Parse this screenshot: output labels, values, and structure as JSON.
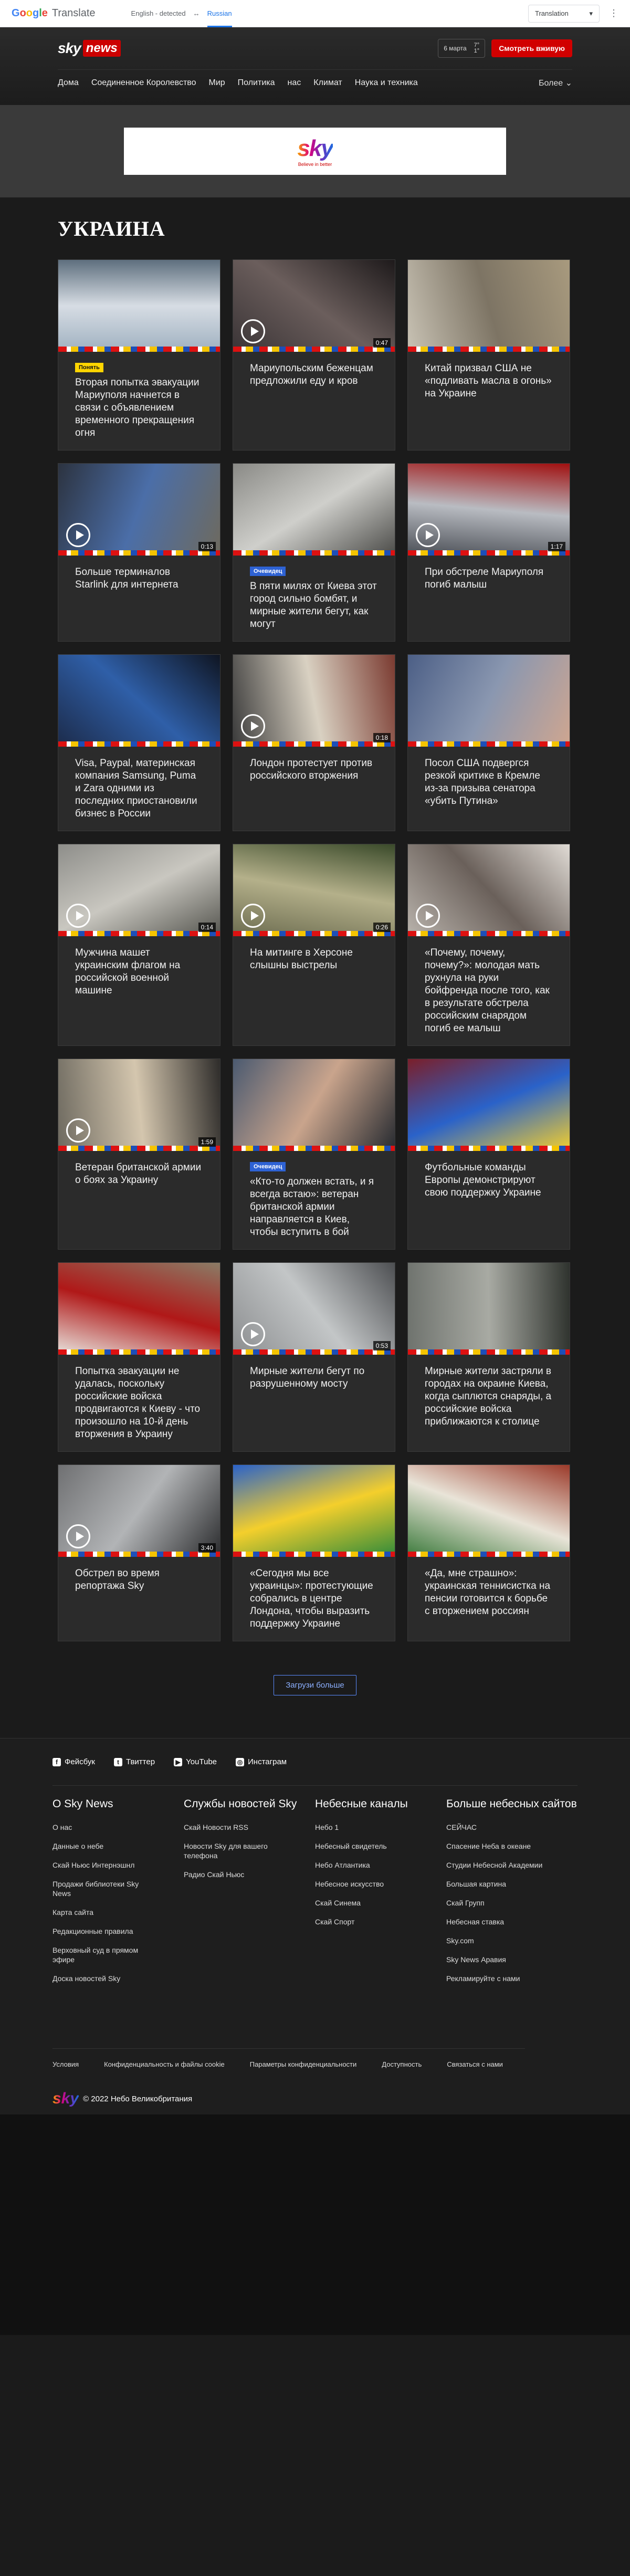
{
  "translate_bar": {
    "logo_google": "Google",
    "logo_translate": "Translate",
    "source_lang": "English - detected",
    "arrow": "↔",
    "target_lang": "Russian",
    "mode": "Translation",
    "menu": "⋮"
  },
  "header": {
    "logo_sky": "sky",
    "logo_news": "news",
    "date": "6 марта",
    "temp_high": "7°",
    "temp_low": "1°",
    "live_button": "Смотреть вживую",
    "nav": [
      "Дома",
      "Соединенное Королевство",
      "Мир",
      "Политика",
      "нас",
      "Климат",
      "Наука и техника"
    ],
    "more": "Более ⌄"
  },
  "ad": {
    "logo": "sky",
    "tagline": "Believe in better"
  },
  "page_title": "УКРАИНА",
  "articles": [
    {
      "headline": "Вторая попытка эвакуации Мариуполя начнется в связи с объявлением временного прекращения огня",
      "badge": "Понять",
      "badge_type": "yellow",
      "video": false,
      "duration": "",
      "colors": [
        "#9fb0c0",
        "#d7dde4",
        "#5e6f7e"
      ]
    },
    {
      "headline": "Мариупольским беженцам предложили еду и кров",
      "badge": "",
      "badge_type": "",
      "video": true,
      "duration": "0:47",
      "colors": [
        "#3a3436",
        "#6b5e5c",
        "#1e1a1b"
      ]
    },
    {
      "headline": "Китай призвал США не «подливать масла в огонь» на Украине",
      "badge": "",
      "badge_type": "",
      "video": false,
      "duration": "",
      "colors": [
        "#c8c2b4",
        "#7d7464",
        "#a89a7e"
      ]
    },
    {
      "headline": "Больше терминалов Starlink для интернета",
      "badge": "",
      "badge_type": "",
      "video": true,
      "duration": "0:13",
      "colors": [
        "#2c3340",
        "#4b6ea8",
        "#6e6a5e"
      ]
    },
    {
      "headline": "В пяти милях от Киева этот город сильно бомбят, и мирные жители бегут, как могут",
      "badge": "Очевидец",
      "badge_type": "blue",
      "video": false,
      "duration": "",
      "colors": [
        "#8a8a86",
        "#cfcfcb",
        "#4b4b48"
      ]
    },
    {
      "headline": "При обстреле Мариуполя погиб малыш",
      "badge": "",
      "badge_type": "",
      "video": true,
      "duration": "1:17",
      "colors": [
        "#4a4e55",
        "#b9bcc2",
        "#a01010"
      ]
    },
    {
      "headline": "Visa, Paypal, материнская компания Samsung, Puma и Zara одними из последних приостановили бизнес в России",
      "badge": "",
      "badge_type": "",
      "video": false,
      "duration": "",
      "colors": [
        "#1c2b4a",
        "#2f5fa8",
        "#0f1522"
      ]
    },
    {
      "headline": "Лондон протестует против российского вторжения",
      "badge": "",
      "badge_type": "",
      "video": true,
      "duration": "0:18",
      "colors": [
        "#3b3b3b",
        "#d9d1c2",
        "#7a3a30"
      ]
    },
    {
      "headline": "Посол США подвергся резкой критике в Кремле из-за призыва сенатора «убить Путина»",
      "badge": "",
      "badge_type": "",
      "video": false,
      "duration": "",
      "colors": [
        "#4c5f86",
        "#8a97b0",
        "#cfa690"
      ]
    },
    {
      "headline": "Мужчина машет украинским флагом на российской военной машине",
      "badge": "",
      "badge_type": "",
      "video": true,
      "duration": "0:14",
      "colors": [
        "#8e8e8a",
        "#c9c7c0",
        "#55554f"
      ]
    },
    {
      "headline": "На митинге в Херсоне слышны выстрелы",
      "badge": "",
      "badge_type": "",
      "video": true,
      "duration": "0:26",
      "colors": [
        "#6c6c50",
        "#b4b08a",
        "#3a4a2a"
      ]
    },
    {
      "headline": "«Почему, почему, почему?»: молодая мать рухнула на руки бойфренда после того, как в результате обстрела российским снарядом погиб ее малыш",
      "badge": "",
      "badge_type": "",
      "video": true,
      "duration": "",
      "colors": [
        "#b9b3ac",
        "#6a605a",
        "#e0dbd5"
      ]
    },
    {
      "headline": "Ветеран британской армии о боях за Украину",
      "badge": "",
      "badge_type": "",
      "video": true,
      "duration": "1:59",
      "colors": [
        "#6e6a60",
        "#d4c6ae",
        "#2e2c2a"
      ]
    },
    {
      "headline": "«Кто-то должен встать, и я всегда встаю»: ветеран британской армии направляется в Киев, чтобы вступить в бой",
      "badge": "Очевидец",
      "badge_type": "blue",
      "video": false,
      "duration": "",
      "colors": [
        "#4b5a70",
        "#c9a48c",
        "#262a30"
      ]
    },
    {
      "headline": "Футбольные команды Европы демонстрируют свою поддержку Украине",
      "badge": "",
      "badge_type": "",
      "video": false,
      "duration": "",
      "colors": [
        "#7a1f2a",
        "#2a62c9",
        "#f4cf2c"
      ]
    },
    {
      "headline": "Попытка эвакуации не удалась, поскольку российские войска продвигаются к Киеву - что произошло на 10-й день вторжения в Украину",
      "badge": "",
      "badge_type": "",
      "video": false,
      "duration": "",
      "colors": [
        "#e8e5df",
        "#b01818",
        "#8a7c66"
      ]
    },
    {
      "headline": "Мирные жители бегут по разрушенному мосту",
      "badge": "",
      "badge_type": "",
      "video": true,
      "duration": "0:53",
      "colors": [
        "#8b8d8f",
        "#c3c6c7",
        "#4d4f52"
      ]
    },
    {
      "headline": "Мирные жители застряли в городах на окраине Киева, когда сыплются снаряды, а российские войска приближаются к столице",
      "badge": "",
      "badge_type": "",
      "video": false,
      "duration": "",
      "colors": [
        "#6f736e",
        "#a8aaa3",
        "#2f332e"
      ]
    },
    {
      "headline": "Обстрел во время репортажа Sky",
      "badge": "",
      "badge_type": "",
      "video": true,
      "duration": "3:40",
      "colors": [
        "#6f7072",
        "#b2b4b6",
        "#2b2c2e"
      ]
    },
    {
      "headline": "«Сегодня мы все украинцы»: протестующие собрались в центре Лондона, чтобы выразить поддержку Украине",
      "badge": "",
      "badge_type": "",
      "video": false,
      "duration": "",
      "colors": [
        "#2a62c9",
        "#f4cf2c",
        "#2f8a3a"
      ]
    },
    {
      "headline": "«Да, мне страшно»: украинская теннисистка на пенсии готовится к борьбе с вторжением россиян",
      "badge": "",
      "badge_type": "",
      "video": false,
      "duration": "",
      "colors": [
        "#3c7a3c",
        "#e9e4d8",
        "#9b3a2a"
      ]
    }
  ],
  "load_more": "Загрузи больше",
  "footer": {
    "social": [
      {
        "icon": "facebook-icon",
        "glyph": "f",
        "label": "Фейсбук"
      },
      {
        "icon": "twitter-icon",
        "glyph": "t",
        "label": "Твиттер"
      },
      {
        "icon": "youtube-icon",
        "glyph": "▶",
        "label": "YouTube"
      },
      {
        "icon": "instagram-icon",
        "glyph": "◎",
        "label": "Инстаграм"
      }
    ],
    "columns": [
      {
        "title": "О Sky News",
        "links": [
          "О нас",
          "Данные о небе",
          "Скай Ньюс Интернэшнл",
          "Продажи библиотеки Sky News",
          "Карта сайта",
          "Редакционные правила",
          "Верховный суд в прямом эфире",
          "Доска новостей Sky"
        ]
      },
      {
        "title": "Службы новостей Sky",
        "links": [
          "Скай Новости RSS",
          "Новости Sky для вашего телефона",
          "Радио Скай Ньюс"
        ]
      },
      {
        "title": "Небесные каналы",
        "links": [
          "Небо 1",
          "Небесный свидетель",
          "Небо Атлантика",
          "Небесное искусство",
          "Скай Синема",
          "Скай Спорт"
        ]
      },
      {
        "title": "Больше небесных сайтов",
        "links": [
          "СЕЙЧАС",
          "Спасение Неба в океане",
          "Студии Небесной Академии",
          "Большая картина",
          "Скай Групп",
          "Небесная ставка",
          "Sky.com",
          "Sky News Аравия",
          "Рекламируйте с нами"
        ]
      }
    ],
    "legal": [
      "Условия",
      "Конфиденциальность и файлы cookie",
      "Параметры конфиденциальности",
      "Доступность",
      "Связаться с нами"
    ],
    "logo": "sky",
    "copyright": "© 2022 Небо Великобритания"
  }
}
